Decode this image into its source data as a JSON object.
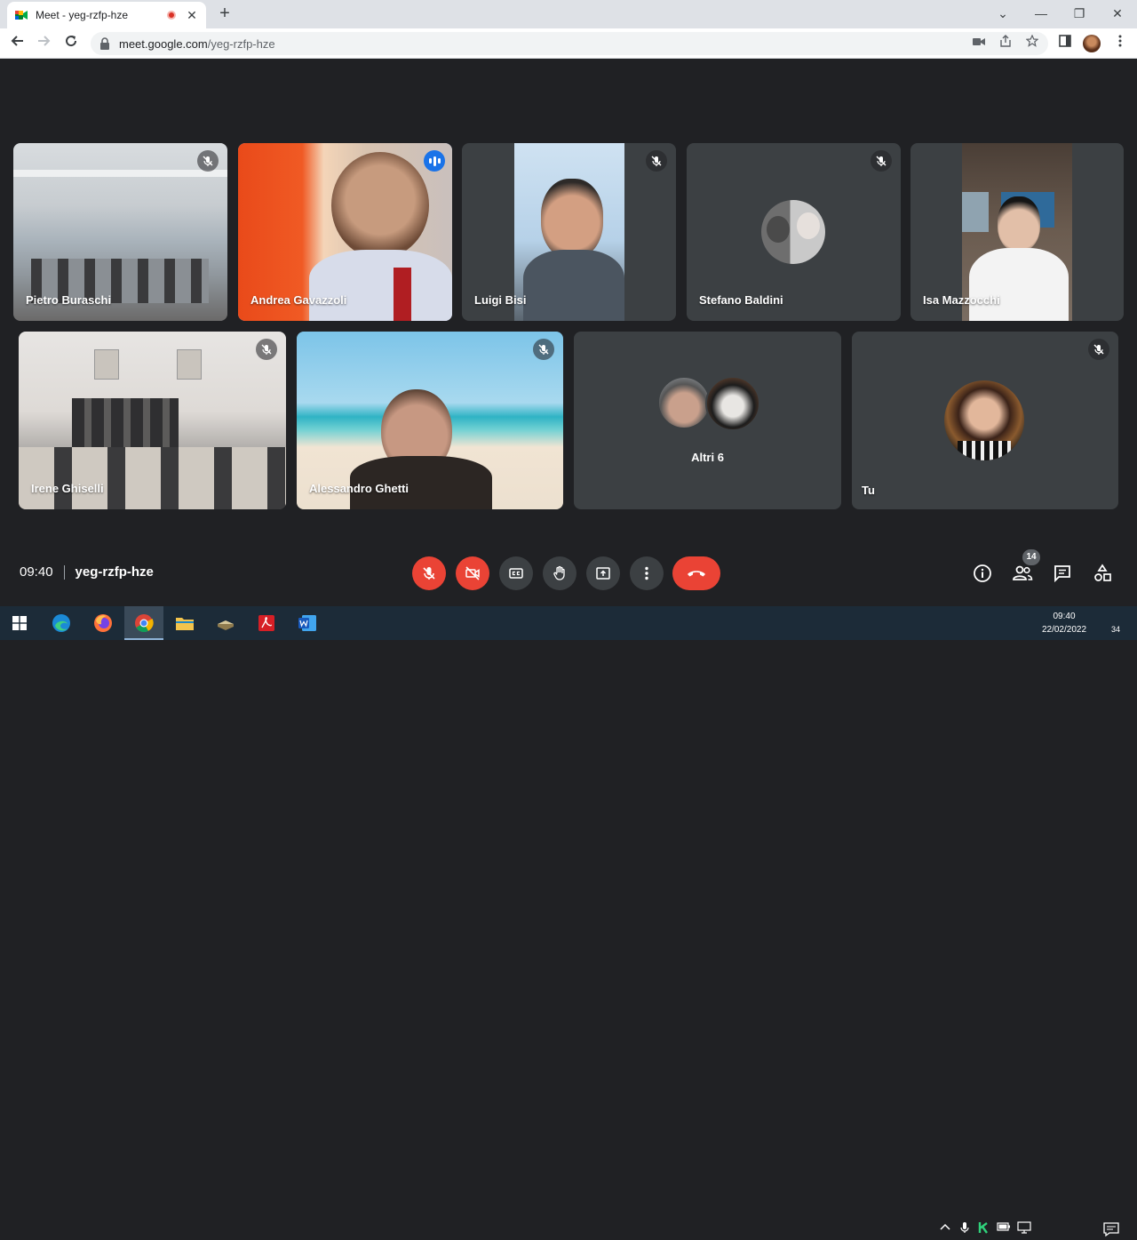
{
  "browser": {
    "tab_title": "Meet - yeg-rzfp-hze",
    "tab_close": "✕",
    "new_tab": "+",
    "window_controls": [
      "⌄",
      "—",
      "❐",
      "✕"
    ],
    "url_host": "meet.google.com",
    "url_path": "/yeg-rzfp-hze"
  },
  "participants": [
    {
      "name": "Pietro Buraschi",
      "muted": true
    },
    {
      "name": "Andrea Gavazzoli",
      "speaking": true
    },
    {
      "name": "Luigi Bisi",
      "muted": true
    },
    {
      "name": "Stefano Baldini",
      "muted": true
    },
    {
      "name": "Isa Mazzocchi",
      "muted": false
    },
    {
      "name": "Irene Ghiselli",
      "muted": true
    },
    {
      "name": "Alessandro Ghetti",
      "muted": true
    },
    {
      "name": "Altri 6"
    },
    {
      "name": "Tu",
      "muted": true
    }
  ],
  "meeting": {
    "time": "09:40",
    "code": "yeg-rzfp-hze",
    "participant_count": "14"
  },
  "taskbar": {
    "time": "09:40",
    "date": "22/02/2022",
    "notifications": "34"
  },
  "colors": {
    "background": "#202124",
    "tile": "#3c4043",
    "danger": "#ea4335",
    "accent": "#8ab4f8"
  }
}
